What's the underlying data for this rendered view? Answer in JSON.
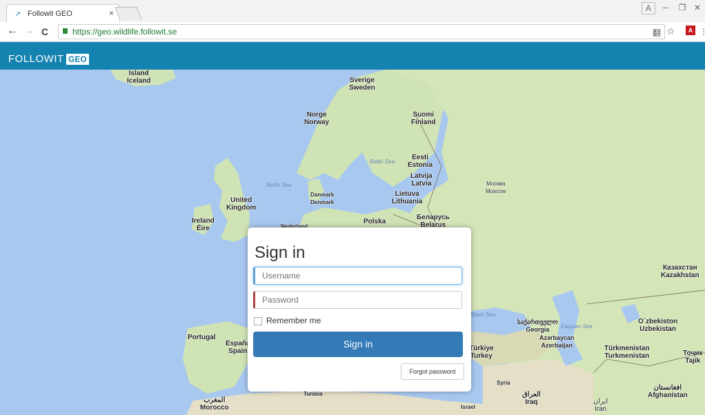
{
  "browser": {
    "tab_title": "Followit GEO",
    "tab_close": "×",
    "url": "https://geo.wildlife.followit.se",
    "back": "←",
    "forward": "→",
    "reload": "C",
    "star": "☆",
    "translate": "翻",
    "menu": "⋮",
    "pdf": "A",
    "win_user": "A",
    "win_min": "─",
    "win_restore": "❐",
    "win_close": "✕"
  },
  "app": {
    "logo": "FOLLOWIT",
    "logo_badge": "GEO"
  },
  "map": {
    "countries": [
      {
        "name": "Iceland",
        "alt": "Ísland"
      },
      {
        "name": "Sverige",
        "alt": "Sweden"
      },
      {
        "name": "Norge",
        "alt": "Norway"
      },
      {
        "name": "Suomi",
        "alt": "Finland"
      },
      {
        "name": "Eesti",
        "alt": "Estonia"
      },
      {
        "name": "Latvija",
        "alt": "Latvia"
      },
      {
        "name": "Lietuva",
        "alt": "Lithuania"
      },
      {
        "name": "Москва",
        "alt": "Moscow"
      },
      {
        "name": "Danmark",
        "alt": "Denmark"
      },
      {
        "name": "United",
        "alt": "Kingdom"
      },
      {
        "name": "Ireland",
        "alt": "Éire"
      },
      {
        "name": "Polska",
        "alt": ""
      },
      {
        "name": "Беларусь",
        "alt": "Belarus"
      },
      {
        "name": "Казахстан",
        "alt": "Kazakhstan"
      },
      {
        "name": "O`zbekiston",
        "alt": "Uzbekistan"
      },
      {
        "name": "Türkmenistan",
        "alt": "Turkmenistan"
      },
      {
        "name": "Portugal",
        "alt": ""
      },
      {
        "name": "España",
        "alt": "Spain"
      },
      {
        "name": "Türkiye",
        "alt": "Turkey"
      },
      {
        "name": "საქართველო",
        "alt": "Georgia"
      },
      {
        "name": "Azərbaycan",
        "alt": "Azerbaijan"
      },
      {
        "name": "العراق",
        "alt": "Iraq"
      },
      {
        "name": "ایران",
        "alt": "Iran"
      },
      {
        "name": "افغانستان",
        "alt": "Afghanistan"
      },
      {
        "name": "المغرب",
        "alt": "Morocco"
      },
      {
        "name": "Israel",
        "alt": ""
      },
      {
        "name": "Тоҷик",
        "alt": "Tajik"
      },
      {
        "name": "Syria",
        "alt": ""
      },
      {
        "name": "Tunisia",
        "alt": ""
      },
      {
        "name": "Nederland",
        "alt": ""
      }
    ],
    "seas": [
      "North Sea",
      "Baltic Sea",
      "Caspian Sea",
      "Black Sea"
    ]
  },
  "login": {
    "title": "Sign in",
    "username_placeholder": "Username",
    "password_placeholder": "Password",
    "remember_label": "Remember me",
    "submit_label": "Sign in",
    "forgot_label": "Forgot password"
  },
  "colors": {
    "appbar": "#1583b0",
    "primary_button": "#337ab7",
    "sea": "#a8c8f0",
    "land": "#cfe3b4",
    "invalid_border": "#a94442"
  }
}
